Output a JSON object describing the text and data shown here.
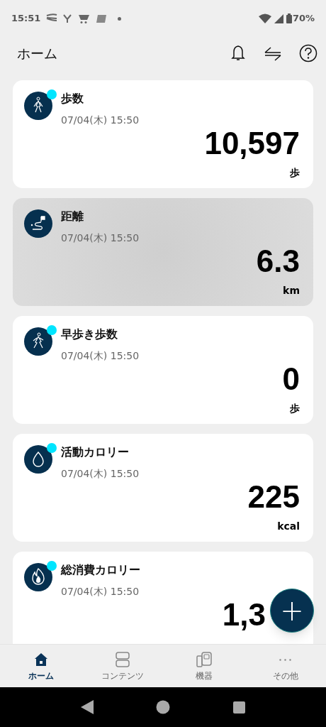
{
  "status_bar": {
    "time": "15:51",
    "battery": "70%"
  },
  "header": {
    "title": "ホーム"
  },
  "cards": [
    {
      "kind": "walk",
      "title": "歩数",
      "date": "07/04(木) 15:50",
      "value": "10,597",
      "unit": "歩",
      "dot": true,
      "highlighted": false,
      "under_button": false
    },
    {
      "kind": "distance",
      "title": "距離",
      "date": "07/04(木) 15:50",
      "value": "6.3",
      "unit": "km",
      "dot": false,
      "highlighted": true,
      "under_button": false
    },
    {
      "kind": "brisk",
      "title": "早歩き歩数",
      "date": "07/04(木) 15:50",
      "value": "0",
      "unit": "歩",
      "dot": true,
      "highlighted": false,
      "under_button": false
    },
    {
      "kind": "flame",
      "title": "活動カロリー",
      "date": "07/04(木) 15:50",
      "value": "225",
      "unit": "kcal",
      "dot": true,
      "highlighted": false,
      "under_button": false
    },
    {
      "kind": "flame2",
      "title": "総消費カロリー",
      "date": "07/04(木) 15:50",
      "value": "1,3",
      "dot": true,
      "highlighted": false,
      "under_button": true
    }
  ],
  "fab": {
    "label": "+"
  },
  "nav": [
    {
      "kind": "home",
      "label": "ホーム",
      "selected": true
    },
    {
      "kind": "contents",
      "label": "コンテンツ",
      "selected": false
    },
    {
      "kind": "devices",
      "label": "機器",
      "selected": false
    },
    {
      "kind": "more",
      "label": "その他",
      "selected": false
    }
  ]
}
